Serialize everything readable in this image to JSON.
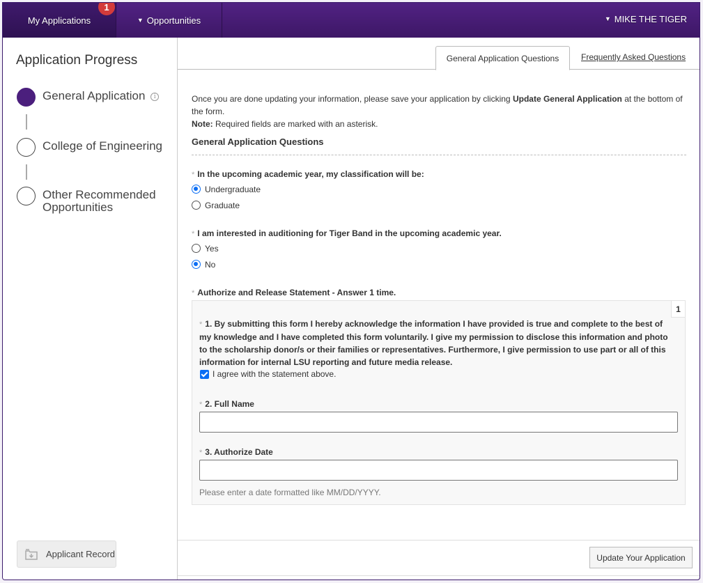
{
  "navbar": {
    "my_applications": "My Applications",
    "my_applications_badge": "1",
    "opportunities": "Opportunities",
    "user_name": "MIKE THE TIGER"
  },
  "sidebar": {
    "title": "Application Progress",
    "steps": [
      {
        "label": "General Application",
        "status": "current"
      },
      {
        "label": "College of Engineering",
        "status": "pending"
      },
      {
        "label": "Other Recommended Opportunities",
        "status": "pending"
      }
    ],
    "applicant_record": "Applicant Record"
  },
  "tabs": {
    "active": "General Application Questions",
    "faq": "Frequently Asked Questions"
  },
  "form": {
    "intro_before": "Once you are done updating your information, please save your application by clicking ",
    "intro_bold": "Update General Application",
    "intro_after": " at the bottom of the form.",
    "note_label": "Note:",
    "note_text": " Required fields are marked with an asterisk.",
    "section_title": "General Application Questions",
    "required_marker": "*",
    "q1": {
      "label": "In the upcoming academic year, my classification will be:",
      "options": [
        "Undergraduate",
        "Graduate"
      ],
      "selected": "Undergraduate"
    },
    "q2": {
      "label": "I am interested in auditioning for Tiger Band in the upcoming academic year.",
      "options": [
        "Yes",
        "No"
      ],
      "selected": "No"
    },
    "q3": {
      "label": "Authorize and Release Statement - Answer 1 time.",
      "count": "1",
      "statement": "1. By submitting this form I hereby acknowledge the information I have provided is true and complete to the best of my knowledge and I have completed this form voluntarily. I give my permission to disclose this information and photo to the scholarship donor/s or their families or representatives. Furthermore, I give permission to use part or all of this information for internal LSU reporting and future media release.",
      "agree_label": "I agree with the statement above.",
      "agree_checked": true,
      "full_name_label": "2. Full Name",
      "full_name_value": "",
      "date_label": "3. Authorize Date",
      "date_value": "",
      "date_hint": "Please enter a date formatted like MM/DD/YYYY."
    }
  },
  "footer": {
    "update_button": "Update Your Application"
  }
}
